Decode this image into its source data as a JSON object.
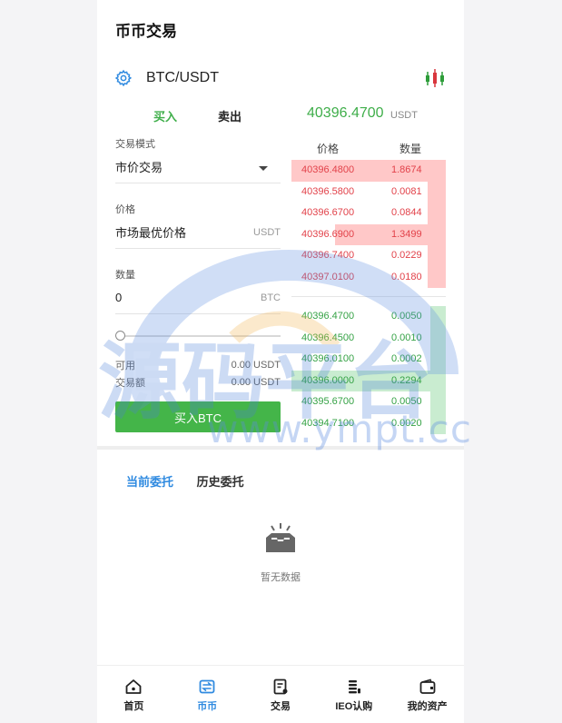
{
  "header": {
    "title": "币币交易"
  },
  "pair": {
    "name": "BTC/USDT"
  },
  "tabs": {
    "buy": "买入",
    "sell": "卖出"
  },
  "ticker": {
    "price": "40396.4700",
    "unit": "USDT"
  },
  "form": {
    "mode_label": "交易模式",
    "mode_value": "市价交易",
    "price_label": "价格",
    "price_value": "市场最优价格",
    "price_unit": "USDT",
    "qty_label": "数量",
    "qty_value": "0",
    "qty_unit": "BTC",
    "slider_percent": 0,
    "available_label": "可用",
    "available_value": "0.00 USDT",
    "amount_label": "交易额",
    "amount_value": "0.00 USDT",
    "submit_label": "买入BTC"
  },
  "orderbook": {
    "price_header": "价格",
    "qty_header": "数量",
    "asks": [
      {
        "price": "40396.4800",
        "qty": "1.8674",
        "depth": 1.0
      },
      {
        "price": "40396.5800",
        "qty": "0.0081",
        "depth": 0.12
      },
      {
        "price": "40396.6700",
        "qty": "0.0844",
        "depth": 0.12
      },
      {
        "price": "40396.6900",
        "qty": "1.3499",
        "depth": 0.72
      },
      {
        "price": "40396.7400",
        "qty": "0.0229",
        "depth": 0.12
      },
      {
        "price": "40397.0100",
        "qty": "0.0180",
        "depth": 0.12
      }
    ],
    "bids": [
      {
        "price": "40396.4700",
        "qty": "0.0050",
        "depth": 0.1
      },
      {
        "price": "40396.4500",
        "qty": "0.0010",
        "depth": 0.1
      },
      {
        "price": "40396.0100",
        "qty": "0.0002",
        "depth": 0.1
      },
      {
        "price": "40396.0000",
        "qty": "0.2294",
        "depth": 1.0
      },
      {
        "price": "40395.6700",
        "qty": "0.0050",
        "depth": 0.1
      },
      {
        "price": "40394.7100",
        "qty": "0.0020",
        "depth": 0.1
      }
    ]
  },
  "orders": {
    "current_tab": "当前委托",
    "history_tab": "历史委托",
    "empty_text": "暂无数据"
  },
  "nav": [
    {
      "label": "首页",
      "icon": "home-icon"
    },
    {
      "label": "币币",
      "icon": "exchange-icon"
    },
    {
      "label": "交易",
      "icon": "trade-icon"
    },
    {
      "label": "IEO认购",
      "icon": "ieo-icon"
    },
    {
      "label": "我的资产",
      "icon": "wallet-icon"
    }
  ],
  "watermark": {
    "text": "源码平台",
    "url": "www.ympt.cc"
  },
  "colors": {
    "green": "#44b549",
    "red": "#e2424a",
    "blue": "#2f8ae0"
  }
}
